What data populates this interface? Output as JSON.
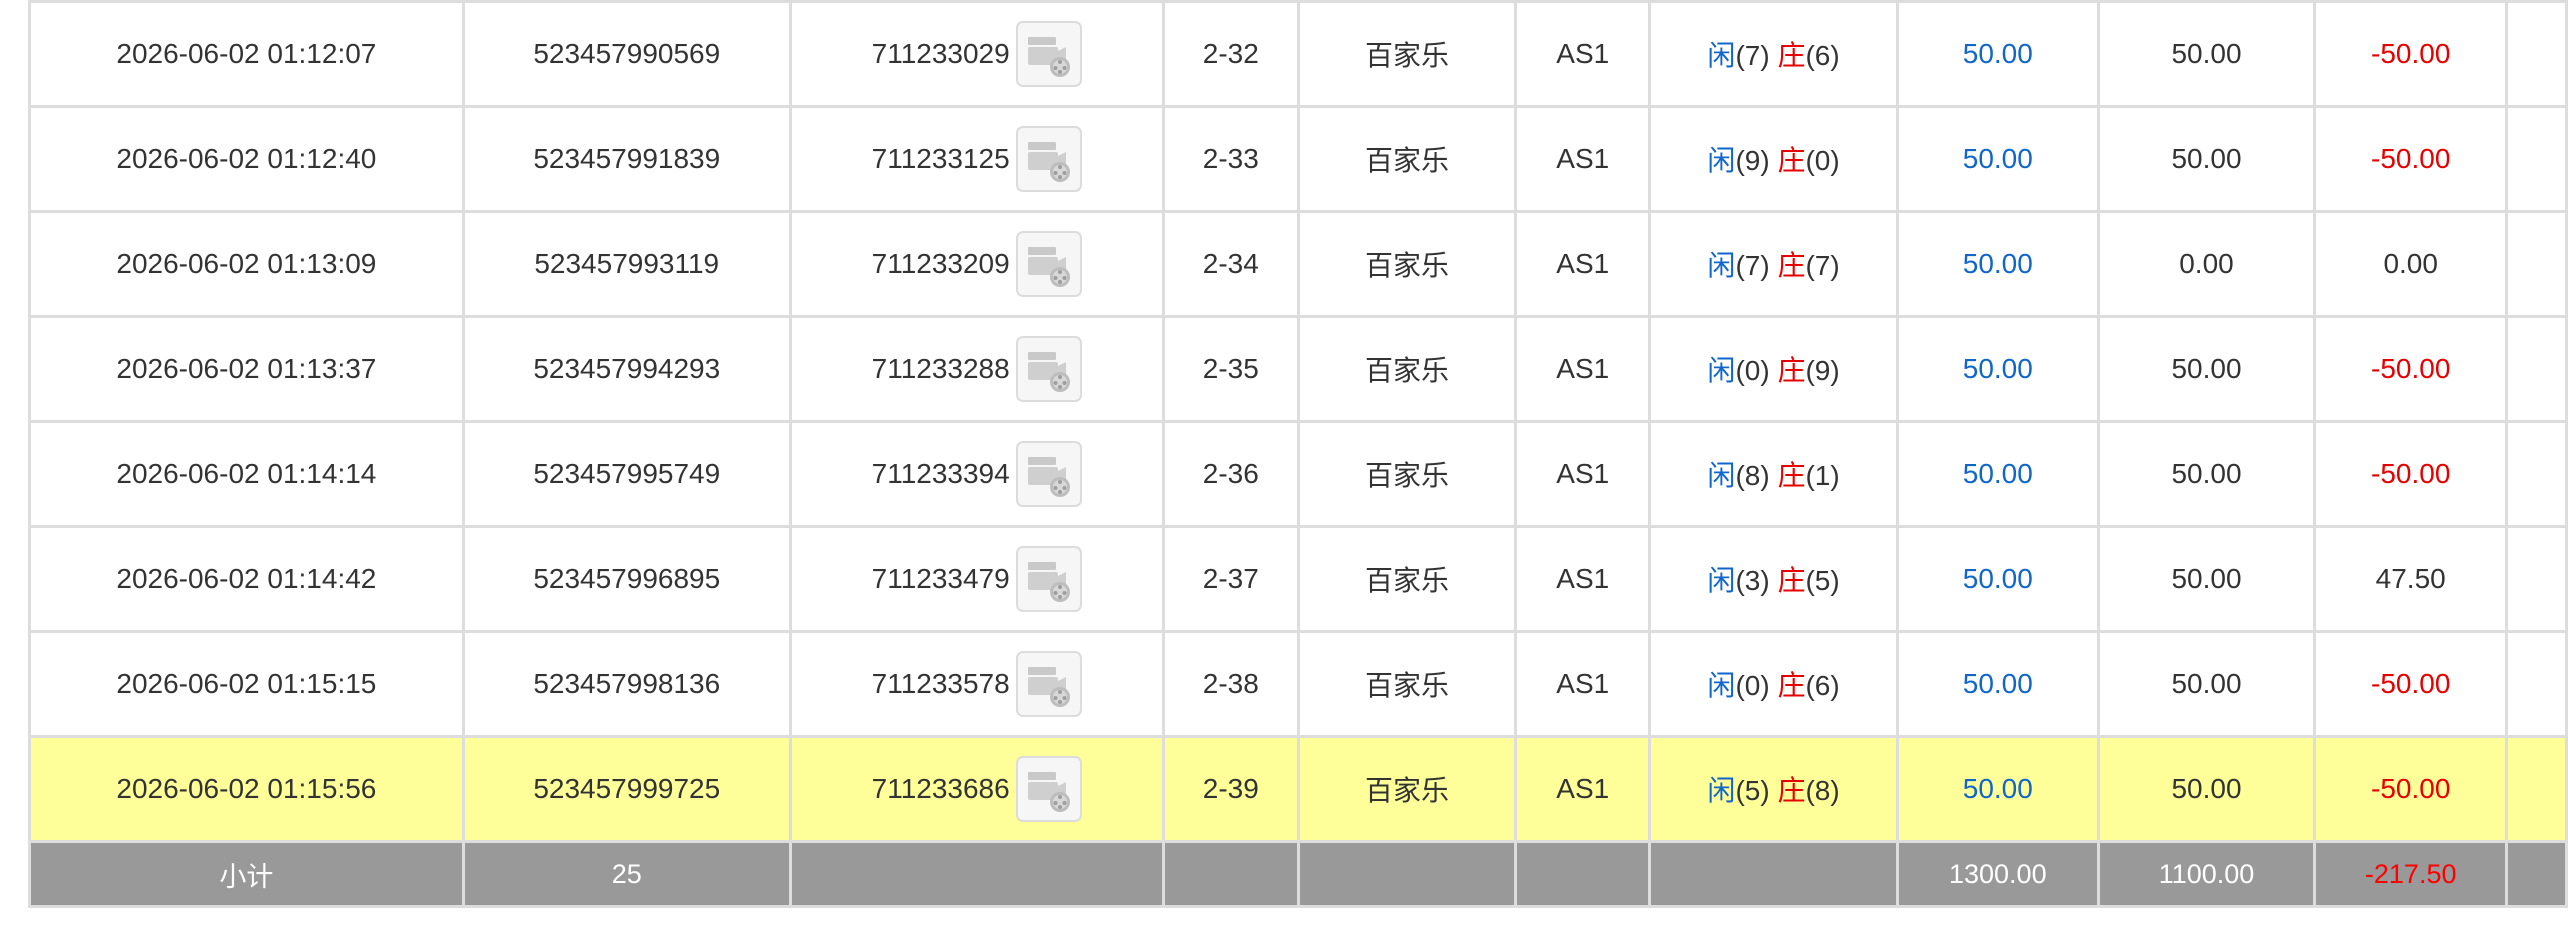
{
  "rows": [
    {
      "time": "2026-06-02 01:12:07",
      "bet_id": "523457990569",
      "round_id": "711233029",
      "shoe": "2-32",
      "game": "百家乐",
      "table": "AS1",
      "player_label": "闲",
      "player_pts": "(7)",
      "banker_label": "庄",
      "banker_pts": "(6)",
      "bet_amount": "50.00",
      "valid_bet": "50.00",
      "win_loss": "-50.00",
      "win_loss_negative": true,
      "highlight": false
    },
    {
      "time": "2026-06-02 01:12:40",
      "bet_id": "523457991839",
      "round_id": "711233125",
      "shoe": "2-33",
      "game": "百家乐",
      "table": "AS1",
      "player_label": "闲",
      "player_pts": "(9)",
      "banker_label": "庄",
      "banker_pts": "(0)",
      "bet_amount": "50.00",
      "valid_bet": "50.00",
      "win_loss": "-50.00",
      "win_loss_negative": true,
      "highlight": false
    },
    {
      "time": "2026-06-02 01:13:09",
      "bet_id": "523457993119",
      "round_id": "711233209",
      "shoe": "2-34",
      "game": "百家乐",
      "table": "AS1",
      "player_label": "闲",
      "player_pts": "(7)",
      "banker_label": "庄",
      "banker_pts": "(7)",
      "bet_amount": "50.00",
      "valid_bet": "0.00",
      "win_loss": "0.00",
      "win_loss_negative": false,
      "highlight": false
    },
    {
      "time": "2026-06-02 01:13:37",
      "bet_id": "523457994293",
      "round_id": "711233288",
      "shoe": "2-35",
      "game": "百家乐",
      "table": "AS1",
      "player_label": "闲",
      "player_pts": "(0)",
      "banker_label": "庄",
      "banker_pts": "(9)",
      "bet_amount": "50.00",
      "valid_bet": "50.00",
      "win_loss": "-50.00",
      "win_loss_negative": true,
      "highlight": false
    },
    {
      "time": "2026-06-02 01:14:14",
      "bet_id": "523457995749",
      "round_id": "711233394",
      "shoe": "2-36",
      "game": "百家乐",
      "table": "AS1",
      "player_label": "闲",
      "player_pts": "(8)",
      "banker_label": "庄",
      "banker_pts": "(1)",
      "bet_amount": "50.00",
      "valid_bet": "50.00",
      "win_loss": "-50.00",
      "win_loss_negative": true,
      "highlight": false
    },
    {
      "time": "2026-06-02 01:14:42",
      "bet_id": "523457996895",
      "round_id": "711233479",
      "shoe": "2-37",
      "game": "百家乐",
      "table": "AS1",
      "player_label": "闲",
      "player_pts": "(3)",
      "banker_label": "庄",
      "banker_pts": "(5)",
      "bet_amount": "50.00",
      "valid_bet": "50.00",
      "win_loss": "47.50",
      "win_loss_negative": false,
      "highlight": false
    },
    {
      "time": "2026-06-02 01:15:15",
      "bet_id": "523457998136",
      "round_id": "711233578",
      "shoe": "2-38",
      "game": "百家乐",
      "table": "AS1",
      "player_label": "闲",
      "player_pts": "(0)",
      "banker_label": "庄",
      "banker_pts": "(6)",
      "bet_amount": "50.00",
      "valid_bet": "50.00",
      "win_loss": "-50.00",
      "win_loss_negative": true,
      "highlight": false
    },
    {
      "time": "2026-06-02 01:15:56",
      "bet_id": "523457999725",
      "round_id": "711233686",
      "shoe": "2-39",
      "game": "百家乐",
      "table": "AS1",
      "player_label": "闲",
      "player_pts": "(5)",
      "banker_label": "庄",
      "banker_pts": "(8)",
      "bet_amount": "50.00",
      "valid_bet": "50.00",
      "win_loss": "-50.00",
      "win_loss_negative": true,
      "highlight": true
    }
  ],
  "subtotal": {
    "label": "小计",
    "count": "25",
    "bet_amount": "1300.00",
    "valid_bet": "1100.00",
    "win_loss": "-217.50"
  },
  "icons": {
    "replay": "video-replay-icon"
  },
  "colors": {
    "blue": "#1166cc",
    "red": "#e60000",
    "highlight": "#ffff99",
    "subtotal_bg": "#999999"
  }
}
